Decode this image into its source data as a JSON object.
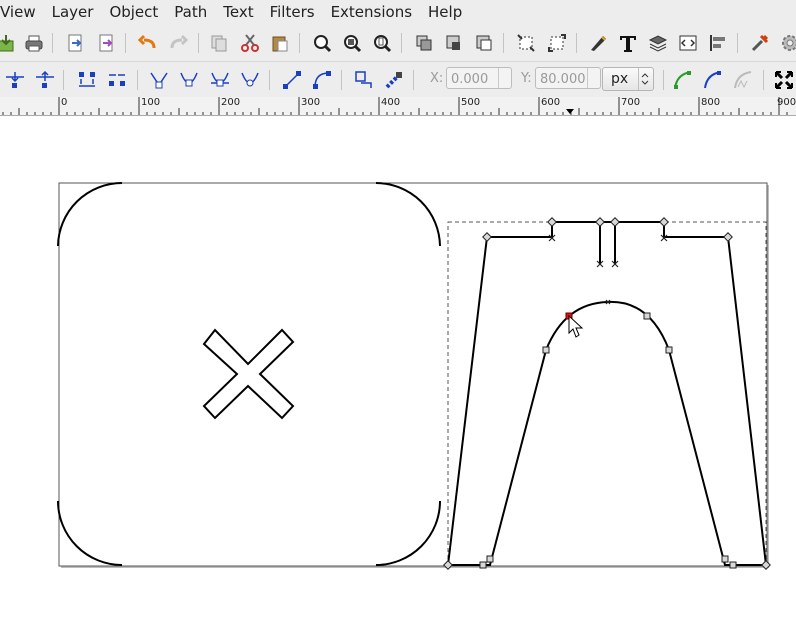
{
  "menu": {
    "items": [
      "View",
      "Layer",
      "Object",
      "Path",
      "Text",
      "Filters",
      "Extensions",
      "Help"
    ]
  },
  "toolbar": {
    "icons": [
      "import-icon",
      "print-icon",
      "export-icon",
      "export-pdf-icon",
      "undo-icon",
      "redo-icon",
      "duplicate-icon",
      "cut-icon",
      "paste-icon",
      "zoom-selection-icon",
      "zoom-drawing-icon",
      "zoom-page-icon",
      "group-icon",
      "lock-icon",
      "ungroup-icon",
      "zoom-fit-icon",
      "resize-icon",
      "edit-icon",
      "text-tool-icon",
      "layers-icon",
      "xml-editor-icon",
      "align-icon",
      "preferences-icon",
      "settings-icon"
    ]
  },
  "node_toolbar": {
    "x_label": "X:",
    "x_value": "0.000",
    "y_label": "Y:",
    "y_value": "80.000",
    "unit": "px"
  },
  "ruler": {
    "labels": [
      "0",
      "100",
      "200",
      "300",
      "400",
      "500",
      "600",
      "700",
      "800",
      "900"
    ]
  },
  "colors": {
    "selected_node": "#e01010",
    "chrome_bg": "#ededed"
  }
}
